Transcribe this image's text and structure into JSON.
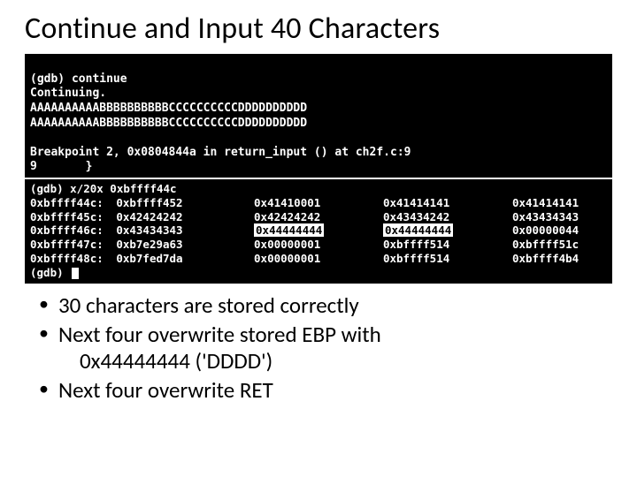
{
  "title": "Continue and Input 40 Characters",
  "term1": {
    "l1": "(gdb) continue",
    "l2": "Continuing.",
    "l3": "AAAAAAAAAABBBBBBBBBBCCCCCCCCCCDDDDDDDDDD",
    "l4": "AAAAAAAAAABBBBBBBBBBCCCCCCCCCCDDDDDDDDDD",
    "l5": "",
    "l6": "Breakpoint 2, 0x0804844a in return_input () at ch2f.c:9",
    "l7": "9       }"
  },
  "term2": {
    "cmd": "(gdb) x/20x 0xbffff44c",
    "rows": [
      {
        "addr": "0xbffff44c:",
        "v1": "0xbffff452",
        "v2": "0x41410001",
        "v3": "0x41414141",
        "v4": "0x41414141",
        "hl2": false,
        "hl3": false
      },
      {
        "addr": "0xbffff45c:",
        "v1": "0x42424242",
        "v2": "0x42424242",
        "v3": "0x43434242",
        "v4": "0x43434343",
        "hl2": false,
        "hl3": false
      },
      {
        "addr": "0xbffff46c:",
        "v1": "0x43434343",
        "v2": "0x44444444",
        "v3": "0x44444444",
        "v4": "0x00000044",
        "hl2": true,
        "hl3": true
      },
      {
        "addr": "0xbffff47c:",
        "v1": "0xb7e29a63",
        "v2": "0x00000001",
        "v3": "0xbffff514",
        "v4": "0xbffff51c",
        "hl2": false,
        "hl3": false
      },
      {
        "addr": "0xbffff48c:",
        "v1": "0xb7fed7da",
        "v2": "0x00000001",
        "v3": "0xbffff514",
        "v4": "0xbffff4b4",
        "hl2": false,
        "hl3": false
      }
    ],
    "prompt": "(gdb) "
  },
  "bullets": {
    "b1": "30 characters are stored correctly",
    "b2a": "Next four overwrite stored EBP with",
    "b2b": "0x44444444 ('DDDD')",
    "b3": "Next four overwrite RET"
  }
}
